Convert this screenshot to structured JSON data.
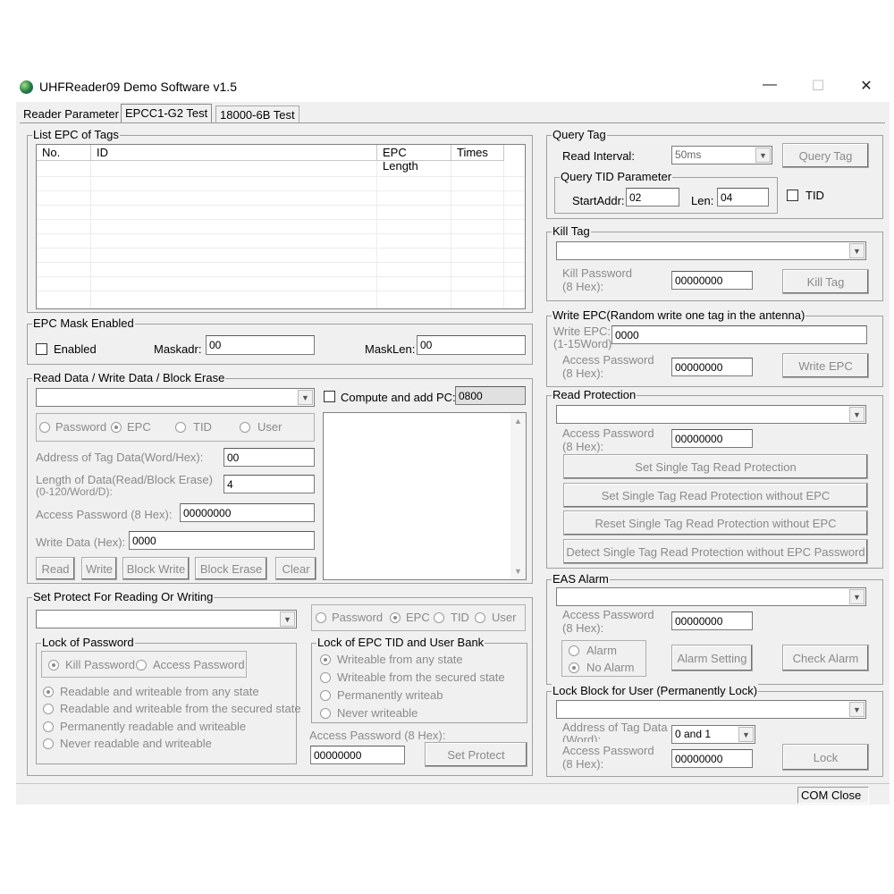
{
  "window": {
    "title": "UHFReader09 Demo Software v1.5",
    "minimize": "—",
    "maximize": "☐",
    "close": "✕"
  },
  "tabs": [
    "Reader Parameter",
    "EPCC1-G2 Test",
    "18000-6B Test"
  ],
  "list_epc": {
    "legend": "List EPC of Tags",
    "columns": [
      "No.",
      "ID",
      "EPC Length",
      "Times"
    ]
  },
  "mask": {
    "legend": "EPC Mask Enabled",
    "enabled_label": "Enabled",
    "maskadr_label": "Maskadr:",
    "maskadr_value": "00",
    "masklen_label": "MaskLen:",
    "masklen_value": "00"
  },
  "rw": {
    "legend": "Read Data / Write Data / Block Erase",
    "compute_label": "Compute and add PC:",
    "pc_value": "0800",
    "radios": [
      "Password",
      "EPC",
      "TID",
      "User"
    ],
    "addr_label": "Address of Tag Data(Word/Hex):",
    "addr_value": "00",
    "len_label1": "Length of Data(Read/Block Erase)",
    "len_label2": "(0-120/Word/D):",
    "len_value": "4",
    "pwd_label": "Access Password (8 Hex):",
    "pwd_value": "00000000",
    "write_label": "Write Data (Hex):",
    "write_value": "0000",
    "buttons": [
      "Read",
      "Write",
      "Block Write",
      "Block Erase",
      "Clear"
    ]
  },
  "protect": {
    "legend": "Set Protect For Reading Or Writing",
    "radios": [
      "Password",
      "EPC",
      "TID",
      "User"
    ],
    "lock_pwd_legend": "Lock of Password",
    "kill_pwd": "Kill Password",
    "access_pwd": "Access Password",
    "pwd_options": [
      "Readable and  writeable from any state",
      "Readable and writeable from the secured state",
      "Permanently readable and writeable",
      "Never readable and writeable"
    ],
    "lock_bank_legend": "Lock of EPC TID and User Bank",
    "bank_options": [
      "Writeable from any state",
      "Writeable from the secured state",
      "Permanently writeab",
      "Never writeable"
    ],
    "access_label": "Access Password (8 Hex):",
    "access_value": "00000000",
    "button": "Set Protect"
  },
  "query": {
    "legend": "Query Tag",
    "interval_label": "Read Interval:",
    "interval_value": "50ms",
    "button": "Query Tag",
    "tid_legend": "Query TID Parameter",
    "start_label": "StartAddr:",
    "start_value": "02",
    "len_label": "Len:",
    "len_value": "04",
    "tid_label": "TID"
  },
  "kill": {
    "legend": "Kill Tag",
    "pwd_label1": "Kill Password",
    "pwd_label2": "(8 Hex):",
    "pwd_value": "00000000",
    "button": "Kill Tag"
  },
  "write_epc": {
    "legend": "Write EPC(Random write one tag in the antenna)",
    "epc_label1": "Write EPC:",
    "epc_label2": "(1-15Word)",
    "epc_value": "0000",
    "pwd_label1": "Access Password",
    "pwd_label2": "(8 Hex):",
    "pwd_value": "00000000",
    "button": "Write EPC"
  },
  "read_protect": {
    "legend": "Read Protection",
    "pwd_label1": "Access Password",
    "pwd_label2": "(8 Hex):",
    "pwd_value": "00000000",
    "buttons": [
      "Set Single Tag Read Protection",
      "Set Single Tag Read Protection without EPC",
      "Reset Single Tag Read Protection without EPC",
      "Detect Single Tag Read Protection without EPC Password"
    ]
  },
  "eas": {
    "legend": "EAS Alarm",
    "pwd_label1": "Access Password",
    "pwd_label2": "(8 Hex):",
    "pwd_value": "00000000",
    "alarm": "Alarm",
    "no_alarm": "No Alarm",
    "setting_button": "Alarm Setting",
    "check_button": "Check Alarm"
  },
  "lock_block": {
    "legend": "Lock Block for User (Permanently Lock)",
    "addr_label1": "Address of Tag Data",
    "addr_label2": "(Word):",
    "addr_value": "0 and 1",
    "pwd_label1": "Access Password",
    "pwd_label2": "(8 Hex):",
    "pwd_value": "00000000",
    "button": "Lock"
  },
  "status": {
    "com": "COM Close"
  }
}
